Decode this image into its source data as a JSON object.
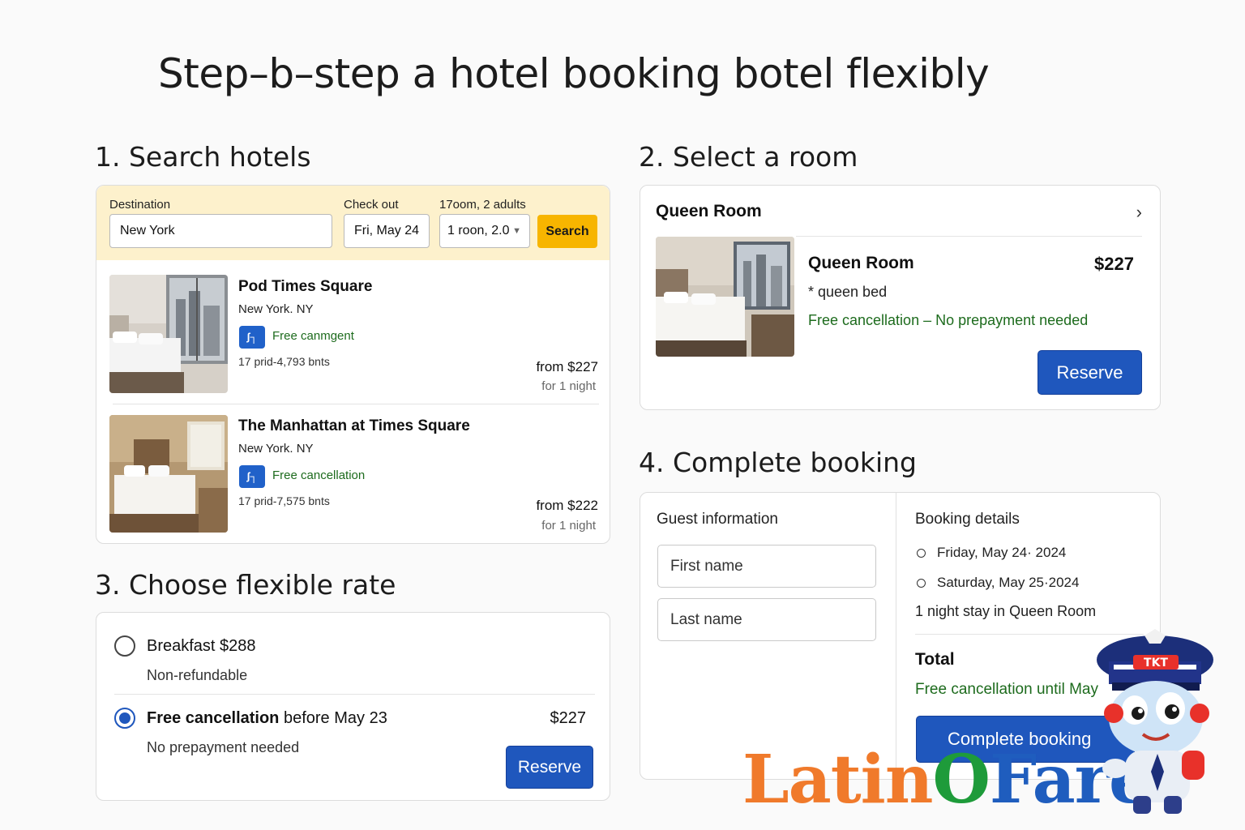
{
  "page": {
    "title": "Step–b–step a hotel booking botel flexibly"
  },
  "search_section": {
    "title": "1. Search hotels",
    "destination_label": "Destination",
    "destination_value": "New York",
    "checkout_label": "Check out",
    "checkout_value": "Fri, May 24",
    "rooms_label": "17oom, 2 adults",
    "rooms_value": "1 roon, 2.0",
    "search_button": "Search",
    "hotels": [
      {
        "name": "Pod Times Square",
        "city": "New York. NY",
        "badge_icon": "ʃ┐",
        "free_text": "Free canmgent",
        "reviews": "17 prid-4,793 bnts",
        "price": "from  $227",
        "per_night": "for 1 night"
      },
      {
        "name": "The Manhattan at Times Square",
        "city": "New York. NY",
        "badge_icon": "ʃ┐",
        "free_text": "Free cancellation",
        "reviews": "17 prid-7,575 bnts",
        "price": "from  $222",
        "per_night": "for 1 night"
      }
    ]
  },
  "room_section": {
    "title": "2. Select a room",
    "header": "Queen Room",
    "room_name": "Queen Room",
    "price": "$227",
    "bed": "* queen bed",
    "free_text": "Free cancellation – No prepayment needed",
    "reserve_button": "Reserve"
  },
  "rate_section": {
    "title": "3. Choose flexible rate",
    "option1_label": "Breakfast $288",
    "option1_sub": "Non-refundable",
    "option2_bold": "Free cancellation",
    "option2_rest": " before May 23",
    "option2_price": "$227",
    "option2_sub": "No prepayment needed",
    "reserve_button": "Reserve"
  },
  "booking_section": {
    "title": "4. Complete booking",
    "guest_heading": "Guest information",
    "first_name_placeholder": "First name",
    "last_name_placeholder": "Last name",
    "details_heading": "Booking details",
    "checkin_date": "Friday, May 24· 2024",
    "checkout_date": "Saturday, May 25·2024",
    "stay_summary": "1 night stay in Queen Room",
    "total_label": "Total",
    "free_until": "Free cancellation until May",
    "complete_button": "Complete booking"
  },
  "logo": {
    "latin": "Latin",
    "o": "O",
    "fare": "Fare",
    "mascot_cap_text": "TKT"
  },
  "colors": {
    "accent_blue": "#1f57bd",
    "search_yellow": "#f7b500",
    "search_bar_bg": "#fdf1cc",
    "free_green": "#1d6b1d",
    "logo_orange": "#f07a2b",
    "logo_green": "#1e9b3a",
    "logo_blue": "#1f5dbe"
  }
}
